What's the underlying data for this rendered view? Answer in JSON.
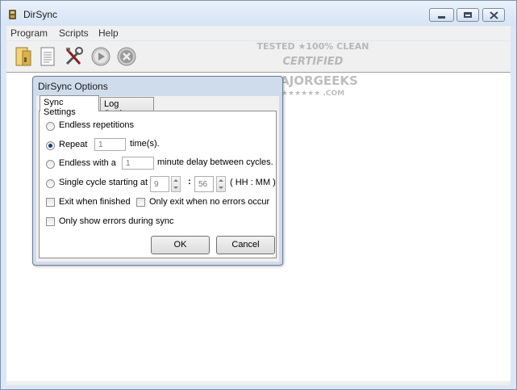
{
  "window": {
    "title": "DirSync"
  },
  "menubar": {
    "items": [
      "Program",
      "Scripts",
      "Help"
    ]
  },
  "toolbar": {
    "icons": [
      "folder-icon",
      "document-icon",
      "tools-icon",
      "play-icon",
      "stop-icon"
    ]
  },
  "watermark": {
    "line1": "TESTED ★100% CLEAN",
    "line2": "CERTIFIED",
    "line3": "MAJORGEEKS",
    "line4": "★★★★★★ .COM"
  },
  "dialog": {
    "title": "DirSync Options",
    "tabs": [
      "Sync Settings",
      "Log Settings"
    ],
    "options": {
      "endless": "Endless repetitions",
      "repeat_label": "Repeat",
      "repeat_value": "1",
      "repeat_suffix": "time(s).",
      "endless_with_label": "Endless with a",
      "endless_with_value": "1",
      "endless_with_suffix": "minute delay between cycles.",
      "single_cycle_label": "Single cycle starting at",
      "hour_value": "9",
      "colon": ":",
      "minute_value": "56",
      "time_format": "( HH : MM )",
      "exit_when_finished": "Exit when finished",
      "only_exit_no_errors": "Only exit when no errors occur",
      "only_show_errors": "Only show errors during sync"
    },
    "selected_option": "repeat",
    "buttons": {
      "ok": "OK",
      "cancel": "Cancel"
    }
  },
  "colors": {
    "accent": "#1d3c6d",
    "frame": "#dbe7f5"
  }
}
